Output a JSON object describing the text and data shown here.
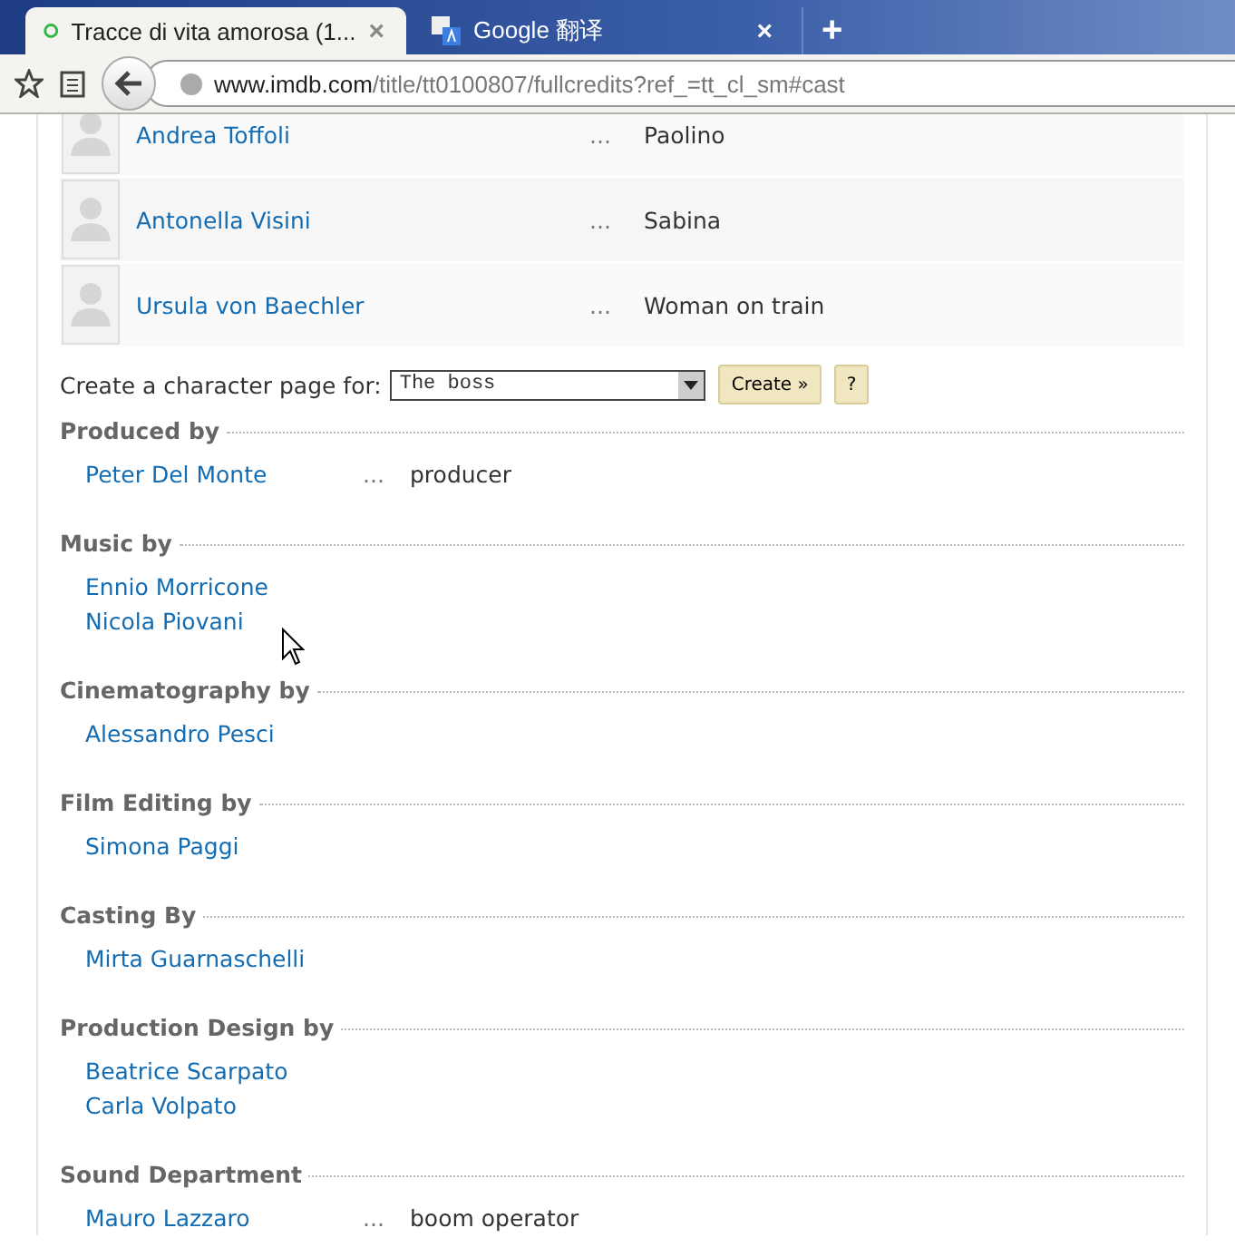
{
  "browser": {
    "tabs": [
      {
        "title": "Tracce di vita amorosa (1...",
        "selected": true,
        "kind": "loading",
        "close": "×"
      },
      {
        "title": "Google 翻译",
        "selected": false,
        "kind": "translate",
        "close": "×"
      }
    ],
    "new_tab": "+",
    "address": {
      "host": "www.imdb.com",
      "path": "/title/tt0100807/fullcredits?ref_=tt_cl_sm#cast"
    }
  },
  "cast": [
    {
      "name": "Andrea Toffoli",
      "dots": "...",
      "character": "Paolino"
    },
    {
      "name": "Antonella Visini",
      "dots": "...",
      "character": "Sabina"
    },
    {
      "name": "Ursula von Baechler",
      "dots": "...",
      "character": "Woman on train"
    }
  ],
  "character_page": {
    "label": "Create a character page for:",
    "value": "The boss",
    "create": "Create »",
    "help": "?"
  },
  "sections": [
    {
      "title": "Produced by",
      "people": [
        {
          "name": "Peter Del Monte",
          "dots": "...",
          "role": "producer"
        }
      ]
    },
    {
      "title": "Music by",
      "people": [
        {
          "name": "Ennio Morricone"
        },
        {
          "name": "Nicola Piovani"
        }
      ]
    },
    {
      "title": "Cinematography by",
      "people": [
        {
          "name": "Alessandro Pesci"
        }
      ]
    },
    {
      "title": "Film Editing by",
      "people": [
        {
          "name": "Simona Paggi"
        }
      ]
    },
    {
      "title": "Casting By",
      "people": [
        {
          "name": "Mirta Guarnaschelli"
        }
      ]
    },
    {
      "title": "Production Design by",
      "people": [
        {
          "name": "Beatrice Scarpato"
        },
        {
          "name": "Carla Volpato"
        }
      ]
    },
    {
      "title": "Sound Department",
      "people": [
        {
          "name": "Mauro Lazzaro",
          "dots": "...",
          "role": "boom operator"
        }
      ]
    }
  ]
}
